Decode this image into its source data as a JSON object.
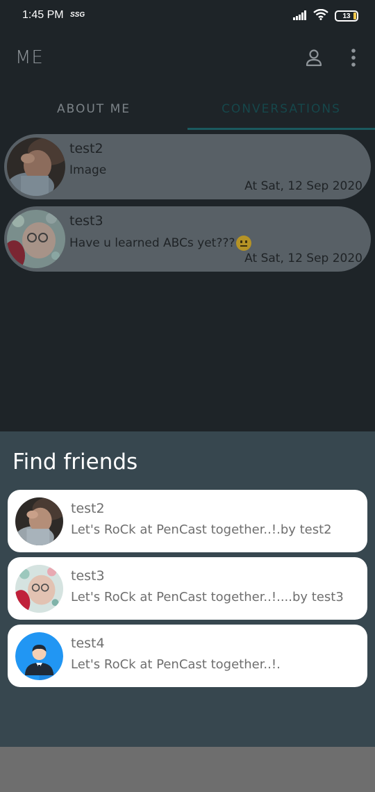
{
  "status_bar": {
    "time": "1:45 PM",
    "network_label": "SSG",
    "battery": "13",
    "icons": [
      "signal-icon",
      "wifi-icon",
      "battery-icon"
    ]
  },
  "app_bar": {
    "title": "ME",
    "icons": [
      "person-icon",
      "more-vert-icon"
    ]
  },
  "tabs": [
    {
      "label": "ABOUT ME",
      "selected": false
    },
    {
      "label": "CONVERSATIONS",
      "selected": true
    }
  ],
  "conversations": [
    {
      "name": "test2",
      "message": "Image",
      "emoji": "",
      "date": "At Sat, 12 Sep 2020"
    },
    {
      "name": "test3",
      "message": "Have u learned ABCs yet???",
      "emoji": "neutral-face",
      "date": "At Sat, 12 Sep 2020"
    }
  ],
  "find_friends": {
    "title": "Find friends",
    "friends": [
      {
        "name": "test2",
        "status": "Let's RoCk at PenCast together..!.by test2",
        "avatar": "baby-photo"
      },
      {
        "name": "test3",
        "status": "Let's RoCk at PenCast together..!....by test3",
        "avatar": "baby-photo-glasses"
      },
      {
        "name": "test4",
        "status": "Let's RoCk at PenCast together..!.",
        "avatar": "default-person-avatar"
      }
    ]
  },
  "colors": {
    "background": "#1e2428",
    "sheet": "#37474f",
    "conversation_bubble": "#586066",
    "tab_accent": "#1b5a5f",
    "card": "#ffffff"
  }
}
